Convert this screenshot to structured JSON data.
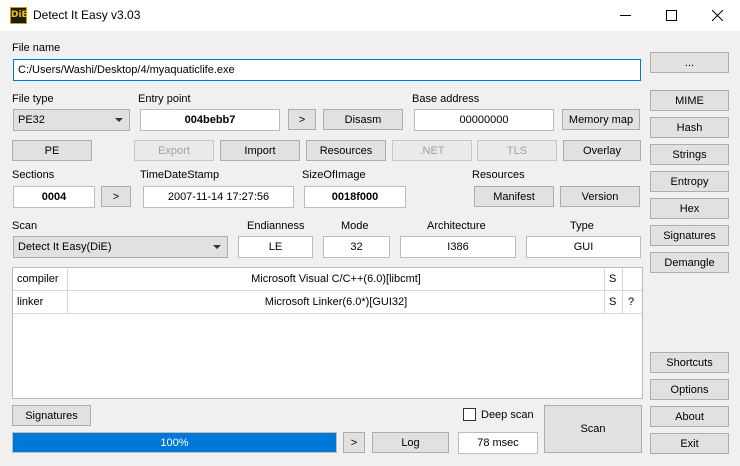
{
  "window": {
    "title": "Detect It Easy v3.03",
    "icon_text": "DiE",
    "controls": {
      "minimize": "minimize-icon",
      "maximize": "maximize-icon",
      "close": "close-icon"
    }
  },
  "file": {
    "label": "File name",
    "value": "C:/Users/Washi/Desktop/4/myaquaticlife.exe"
  },
  "file_type": {
    "label": "File type",
    "value": "PE32"
  },
  "entry_point": {
    "label": "Entry point",
    "value": "004bebb7",
    "next": ">",
    "disasm": "Disasm"
  },
  "base_address": {
    "label": "Base address",
    "value": "00000000",
    "memory_map": "Memory map"
  },
  "pe_buttons": {
    "pe": "PE",
    "export": "Export",
    "import": "Import",
    "resources": "Resources",
    "net": ".NET",
    "tls": "TLS",
    "overlay": "Overlay"
  },
  "sections": {
    "label": "Sections",
    "value": "0004",
    "next": ">"
  },
  "timestamp": {
    "label": "TimeDateStamp",
    "value": "2007-11-14 17:27:56"
  },
  "size_of_image": {
    "label": "SizeOfImage",
    "value": "0018f000"
  },
  "resources": {
    "label": "Resources",
    "manifest": "Manifest",
    "version": "Version"
  },
  "scan": {
    "label": "Scan",
    "value": "Detect It Easy(DiE)"
  },
  "endianness": {
    "label": "Endianness",
    "value": "LE"
  },
  "mode": {
    "label": "Mode",
    "value": "32"
  },
  "architecture": {
    "label": "Architecture",
    "value": "I386"
  },
  "type": {
    "label": "Type",
    "value": "GUI"
  },
  "results": [
    {
      "type": "compiler",
      "name": "Microsoft Visual C/C++(6.0)[libcmt]",
      "s": "S",
      "q": ""
    },
    {
      "type": "linker",
      "name": "Microsoft Linker(6.0*)[GUI32]",
      "s": "S",
      "q": "?"
    }
  ],
  "bottom": {
    "signatures": "Signatures",
    "deep_scan": "Deep scan",
    "deep_scan_checked": false,
    "progress_text": "100%",
    "progress_value": 1.0,
    "next": ">",
    "log": "Log",
    "time": "78 msec",
    "scan": "Scan"
  },
  "side": {
    "dots": "...",
    "mime": "MIME",
    "hash": "Hash",
    "strings": "Strings",
    "entropy": "Entropy",
    "hex": "Hex",
    "signatures": "Signatures",
    "demangle": "Demangle",
    "shortcuts": "Shortcuts",
    "options": "Options",
    "about": "About",
    "exit": "Exit"
  }
}
